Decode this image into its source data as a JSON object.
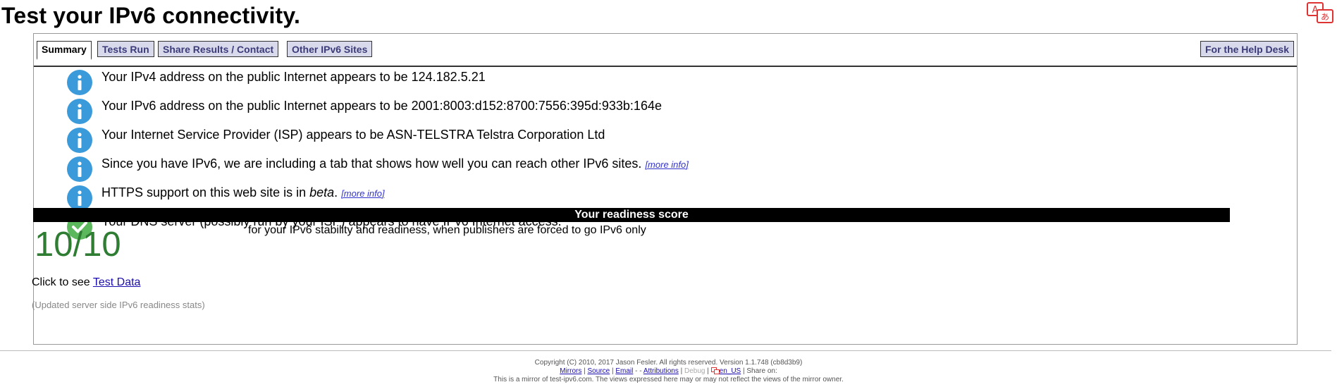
{
  "page": {
    "title": "Test your IPv6 connectivity."
  },
  "tabs": [
    {
      "label": "Summary",
      "active": true
    },
    {
      "label": "Tests Run"
    },
    {
      "label": "Share Results / Contact"
    },
    {
      "label": "Other IPv6 Sites"
    },
    {
      "label": "For the Help Desk"
    }
  ],
  "messages": [
    {
      "icon": "info-icon",
      "text": "Your IPv4 address on the public Internet appears to be 124.182.5.21"
    },
    {
      "icon": "info-icon",
      "text": "Your IPv6 address on the public Internet appears to be 2001:8003:d152:8700:7556:395d:933b:164e"
    },
    {
      "icon": "info-icon",
      "text": "Your Internet Service Provider (ISP) appears to be ASN-TELSTRA Telstra Corporation Ltd"
    },
    {
      "icon": "info-icon",
      "text": "Since you have IPv6, we are including a tab that shows how well you can reach other IPv6 sites.",
      "more": "[more info]"
    },
    {
      "icon": "info-icon",
      "text_prefix": "HTTPS support on this web site is in ",
      "text_em": "beta",
      "text_suffix": ".",
      "more": "[more info]"
    },
    {
      "icon": "check-icon",
      "text": "Your DNS server (possibly run by your ISP) appears to have IPv6 Internet access."
    }
  ],
  "score": {
    "header": "Your readiness score",
    "value": "10/10",
    "description": "for your IPv6 stability and readiness, when publishers are forced to go IPv6 only"
  },
  "test_data": {
    "prefix": "Click to see ",
    "link": "Test Data"
  },
  "updated_stats": "(Updated server side IPv6 readiness stats)",
  "footer": {
    "line1": "Copyright (C) 2010, 2017 Jason Fesler. All rights reserved. Version 1.1.748 (cb8d3b9)",
    "links": [
      "Mirrors",
      "Source",
      "Email",
      "Attributions",
      "Debug",
      "en_US"
    ],
    "share": "Share on:",
    "line3": "This is a mirror of test-ipv6.com. The views expressed here may or may not reflect the views of the mirror owner."
  },
  "colors": {
    "info": "#3b9ad9",
    "check": "#5cb85c",
    "score": "#2e7d32"
  }
}
